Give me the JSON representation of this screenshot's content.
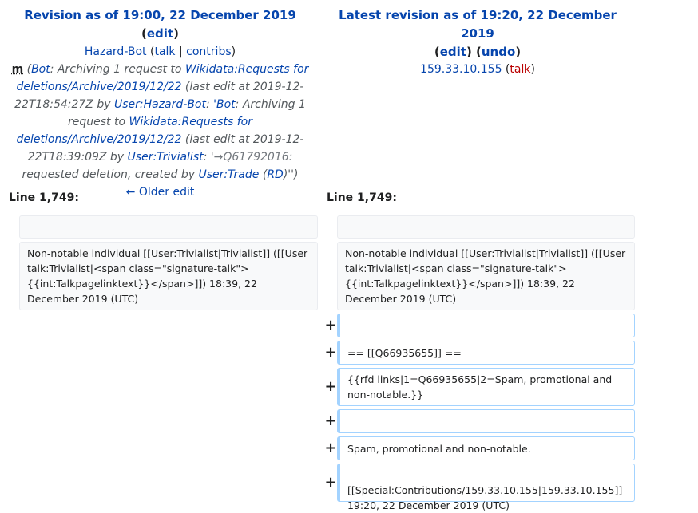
{
  "left_header": {
    "title": "Revision as of 19:00, 22 December 2019",
    "edit": "edit",
    "user": "Hazard-Bot",
    "talk": "talk",
    "contribs": "contribs",
    "minor_flag": "m",
    "summary": {
      "bot_link": "Bot",
      "t1": ": Archiving 1 request to ",
      "link1": "Wikidata:Requests for deletions/Archive/2019/12/22",
      "t2": " (last edit at 2019-12-22T18:54:27Z by ",
      "link2": "User:Hazard-Bot",
      "t3": ": ",
      "bot_link2": "'Bot",
      "t4": ": Archiving 1 request to ",
      "link3": "Wikidata:Requests for deletions/Archive/2019/12/22",
      "t5": " (last edit at 2019-12-22T18:39:09Z by ",
      "link4": "User:Trivialist",
      "t6": ": '",
      "arrow_section": "→Q61792016:",
      "t7": " requested deletion, created by ",
      "link5": "User:Trade",
      "t8": " (",
      "link6": "RD",
      "t9": ")'')"
    },
    "older_edit": "← Older edit"
  },
  "right_header": {
    "title": "Latest revision as of 19:20, 22 December 2019",
    "edit": "edit",
    "undo": "undo",
    "ip": "159.33.10.155",
    "talk": "talk"
  },
  "diff": {
    "line_left": "Line 1,749:",
    "line_right": "Line 1,749:",
    "context_text": "Non-notable individual [[User:Trivialist|Trivialist]] ([[User talk:Trivialist|<span class=\"signature-talk\">{{int:Talkpagelinktext}}</span>]]) 18:39, 22 December 2019 (UTC)",
    "added_marker": "+",
    "added_lines": [
      "",
      "== [[Q66935655]] ==",
      "{{rfd links|1=Q66935655|2=Spam, promotional and non-notable.}}",
      "",
      "Spam, promotional and non-notable.",
      "--[[Special:Contributions/159.33.10.155|159.33.10.155]] 19:20, 22 December 2019 (UTC)"
    ]
  }
}
